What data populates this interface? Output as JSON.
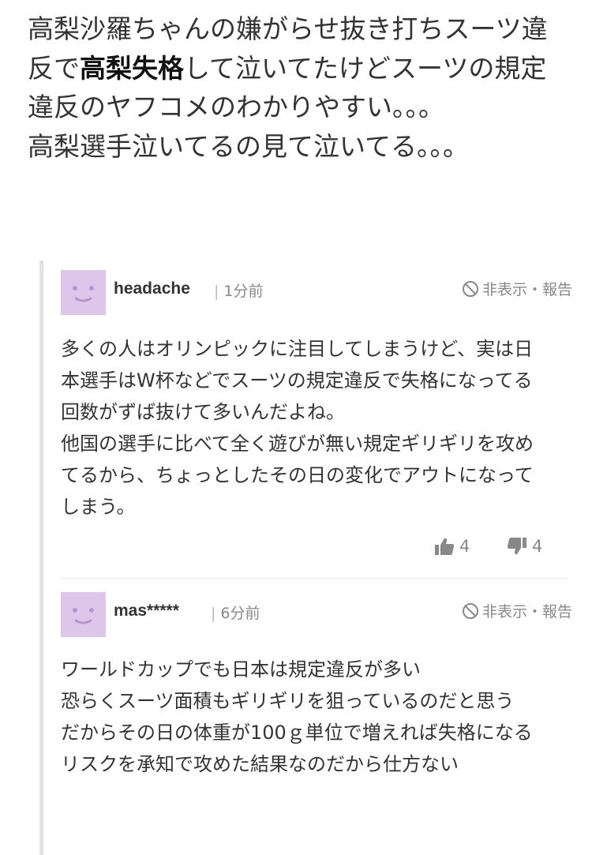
{
  "main_comment": {
    "text_before": "高梨沙羅ちゃんの嫌がらせ抜き打ちスーツ違反で",
    "text_bold": "高梨失格",
    "text_after": "して泣いてたけどスーツの規定違反のヤフコメのわかりやすい。。。\n高梨選手泣いてるの見て泣いてる。。。"
  },
  "replies": [
    {
      "username": "headache",
      "time": "1分前",
      "hide_report": "非表示・報告",
      "body": "多くの人はオリンピックに注目してしまうけど、実は日本選手はW杯などでスーツの規定違反で失格になってる回数がずば抜けて多いんだよね。\n他国の選手に比べて全く遊びが無い規定ギリギリを攻めてるから、ちょっとしたその日の変化でアウトになってしまう。",
      "likes": "4",
      "dislikes": "4"
    },
    {
      "username": "mas*****",
      "time": "6分前",
      "hide_report": "非表示・報告",
      "body": "ワールドカップでも日本は規定違反が多い\n恐らくスーツ面積もギリギリを狙っているのだと思う\nだからその日の体重が100ｇ単位で増えれば失格になる\nリスクを承知で攻めた結果なのだから仕方ない"
    }
  ],
  "icons": {
    "avatar": "smiley-face-icon",
    "hide": "no-entry-icon",
    "like": "thumbs-up-icon",
    "dislike": "thumbs-down-icon"
  },
  "colors": {
    "avatar_bg": "#ddc6ea",
    "avatar_face": "#b893d0",
    "thread_line": "#e2e2e2",
    "meta_text": "#888888"
  }
}
